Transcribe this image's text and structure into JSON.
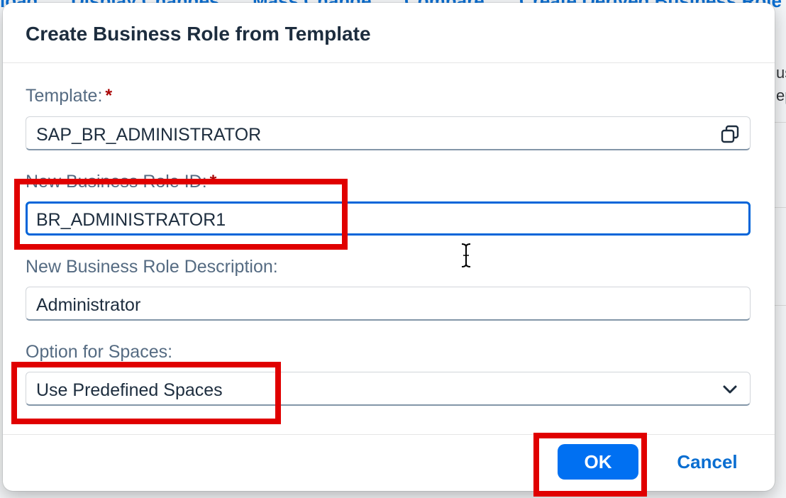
{
  "background": {
    "tabs": [
      "load",
      "Display Changes",
      "Mass Change",
      "Compare",
      "Create Derived Business Role"
    ],
    "right_fragments": [
      "us",
      "ep"
    ]
  },
  "dialog": {
    "title": "Create Business Role from Template",
    "template": {
      "label": "Template:",
      "required_mark": "*",
      "value": "SAP_BR_ADMINISTRATOR",
      "icon": "copy-icon"
    },
    "role_id": {
      "label": "New Business Role ID:",
      "required_mark": "*",
      "value": "BR_ADMINISTRATOR1"
    },
    "description": {
      "label": "New Business Role Description:",
      "value": "Administrator"
    },
    "spaces": {
      "label": "Option for Spaces:",
      "selected": "Use Predefined Spaces",
      "icon": "chevron-down-icon"
    },
    "ok_label": "OK",
    "cancel_label": "Cancel"
  },
  "colors": {
    "primary": "#0070f2",
    "link": "#0a6ed1",
    "required": "#aa0808",
    "highlight": "#e00000"
  }
}
